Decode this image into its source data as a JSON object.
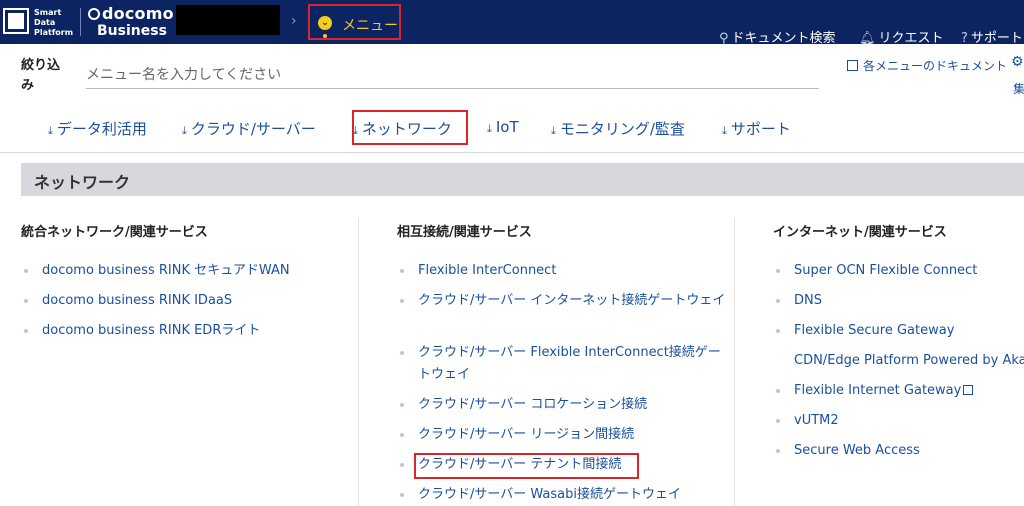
{
  "header": {
    "platform_line1": "Smart",
    "platform_line2": "Data",
    "platform_line3": "Platform",
    "brand_top": "docomo",
    "brand_bottom": "Business",
    "menu_label": "メニュー",
    "tools": {
      "doc_search": "ドキュメント検索",
      "request": "リクエスト",
      "support": "サポート"
    }
  },
  "filter": {
    "label": "絞り込み",
    "placeholder": "メニュー名を入力してください",
    "docs_link": "各メニューのドキュメント",
    "edit_label": "集"
  },
  "categories": [
    {
      "label": "データ利活用"
    },
    {
      "label": "クラウド/サーバー"
    },
    {
      "label": "ネットワーク"
    },
    {
      "label": "IoT"
    },
    {
      "label": "モニタリング/監査"
    },
    {
      "label": "サポート"
    }
  ],
  "section": {
    "title": "ネットワーク",
    "columns": [
      {
        "heading": "統合ネットワーク/関連サービス",
        "items": [
          {
            "label": "docomo business RINK セキュアドWAN"
          },
          {
            "label": "docomo business RINK IDaaS"
          },
          {
            "label": "docomo business RINK EDRライト"
          }
        ]
      },
      {
        "heading": "相互接続/関連サービス",
        "items": [
          {
            "label": "Flexible InterConnect"
          },
          {
            "label": "クラウド/サーバー インターネット接続ゲートウェイ"
          },
          {
            "label": "クラウド/サーバー Flexible InterConnect接続ゲートウェイ"
          },
          {
            "label": "クラウド/サーバー コロケーション接続"
          },
          {
            "label": "クラウド/サーバー リージョン間接続"
          },
          {
            "label": "クラウド/サーバー テナント間接続"
          },
          {
            "label": "クラウド/サーバー Wasabi接続ゲートウェイ"
          }
        ]
      },
      {
        "heading": "インターネット/関連サービス",
        "items": [
          {
            "label": "Super OCN Flexible Connect"
          },
          {
            "label": "DNS"
          },
          {
            "label": "Flexible Secure Gateway"
          },
          {
            "label": "CDN/Edge Platform Powered by Akamai"
          },
          {
            "label": "Flexible Internet Gateway"
          },
          {
            "label": "vUTM2"
          },
          {
            "label": "Secure Web Access"
          }
        ]
      }
    ]
  },
  "colors": {
    "header_bg": "#0c2461",
    "accent_yellow": "#f5cc17",
    "link_blue": "#1a4f9e",
    "highlight_red": "#d9262b",
    "section_bar": "#d6d8de"
  }
}
